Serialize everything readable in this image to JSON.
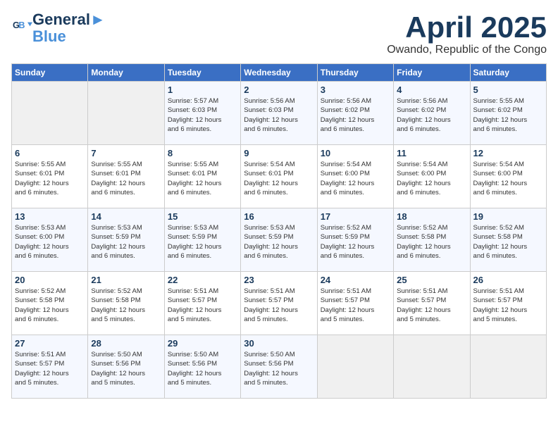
{
  "logo": {
    "line1": "General",
    "line2": "Blue"
  },
  "title": "April 2025",
  "subtitle": "Owando, Republic of the Congo",
  "days_of_week": [
    "Sunday",
    "Monday",
    "Tuesday",
    "Wednesday",
    "Thursday",
    "Friday",
    "Saturday"
  ],
  "weeks": [
    [
      {
        "num": "",
        "info": ""
      },
      {
        "num": "",
        "info": ""
      },
      {
        "num": "1",
        "info": "Sunrise: 5:57 AM\nSunset: 6:03 PM\nDaylight: 12 hours\nand 6 minutes."
      },
      {
        "num": "2",
        "info": "Sunrise: 5:56 AM\nSunset: 6:03 PM\nDaylight: 12 hours\nand 6 minutes."
      },
      {
        "num": "3",
        "info": "Sunrise: 5:56 AM\nSunset: 6:02 PM\nDaylight: 12 hours\nand 6 minutes."
      },
      {
        "num": "4",
        "info": "Sunrise: 5:56 AM\nSunset: 6:02 PM\nDaylight: 12 hours\nand 6 minutes."
      },
      {
        "num": "5",
        "info": "Sunrise: 5:55 AM\nSunset: 6:02 PM\nDaylight: 12 hours\nand 6 minutes."
      }
    ],
    [
      {
        "num": "6",
        "info": "Sunrise: 5:55 AM\nSunset: 6:01 PM\nDaylight: 12 hours\nand 6 minutes."
      },
      {
        "num": "7",
        "info": "Sunrise: 5:55 AM\nSunset: 6:01 PM\nDaylight: 12 hours\nand 6 minutes."
      },
      {
        "num": "8",
        "info": "Sunrise: 5:55 AM\nSunset: 6:01 PM\nDaylight: 12 hours\nand 6 minutes."
      },
      {
        "num": "9",
        "info": "Sunrise: 5:54 AM\nSunset: 6:01 PM\nDaylight: 12 hours\nand 6 minutes."
      },
      {
        "num": "10",
        "info": "Sunrise: 5:54 AM\nSunset: 6:00 PM\nDaylight: 12 hours\nand 6 minutes."
      },
      {
        "num": "11",
        "info": "Sunrise: 5:54 AM\nSunset: 6:00 PM\nDaylight: 12 hours\nand 6 minutes."
      },
      {
        "num": "12",
        "info": "Sunrise: 5:54 AM\nSunset: 6:00 PM\nDaylight: 12 hours\nand 6 minutes."
      }
    ],
    [
      {
        "num": "13",
        "info": "Sunrise: 5:53 AM\nSunset: 6:00 PM\nDaylight: 12 hours\nand 6 minutes."
      },
      {
        "num": "14",
        "info": "Sunrise: 5:53 AM\nSunset: 5:59 PM\nDaylight: 12 hours\nand 6 minutes."
      },
      {
        "num": "15",
        "info": "Sunrise: 5:53 AM\nSunset: 5:59 PM\nDaylight: 12 hours\nand 6 minutes."
      },
      {
        "num": "16",
        "info": "Sunrise: 5:53 AM\nSunset: 5:59 PM\nDaylight: 12 hours\nand 6 minutes."
      },
      {
        "num": "17",
        "info": "Sunrise: 5:52 AM\nSunset: 5:59 PM\nDaylight: 12 hours\nand 6 minutes."
      },
      {
        "num": "18",
        "info": "Sunrise: 5:52 AM\nSunset: 5:58 PM\nDaylight: 12 hours\nand 6 minutes."
      },
      {
        "num": "19",
        "info": "Sunrise: 5:52 AM\nSunset: 5:58 PM\nDaylight: 12 hours\nand 6 minutes."
      }
    ],
    [
      {
        "num": "20",
        "info": "Sunrise: 5:52 AM\nSunset: 5:58 PM\nDaylight: 12 hours\nand 6 minutes."
      },
      {
        "num": "21",
        "info": "Sunrise: 5:52 AM\nSunset: 5:58 PM\nDaylight: 12 hours\nand 5 minutes."
      },
      {
        "num": "22",
        "info": "Sunrise: 5:51 AM\nSunset: 5:57 PM\nDaylight: 12 hours\nand 5 minutes."
      },
      {
        "num": "23",
        "info": "Sunrise: 5:51 AM\nSunset: 5:57 PM\nDaylight: 12 hours\nand 5 minutes."
      },
      {
        "num": "24",
        "info": "Sunrise: 5:51 AM\nSunset: 5:57 PM\nDaylight: 12 hours\nand 5 minutes."
      },
      {
        "num": "25",
        "info": "Sunrise: 5:51 AM\nSunset: 5:57 PM\nDaylight: 12 hours\nand 5 minutes."
      },
      {
        "num": "26",
        "info": "Sunrise: 5:51 AM\nSunset: 5:57 PM\nDaylight: 12 hours\nand 5 minutes."
      }
    ],
    [
      {
        "num": "27",
        "info": "Sunrise: 5:51 AM\nSunset: 5:57 PM\nDaylight: 12 hours\nand 5 minutes."
      },
      {
        "num": "28",
        "info": "Sunrise: 5:50 AM\nSunset: 5:56 PM\nDaylight: 12 hours\nand 5 minutes."
      },
      {
        "num": "29",
        "info": "Sunrise: 5:50 AM\nSunset: 5:56 PM\nDaylight: 12 hours\nand 5 minutes."
      },
      {
        "num": "30",
        "info": "Sunrise: 5:50 AM\nSunset: 5:56 PM\nDaylight: 12 hours\nand 5 minutes."
      },
      {
        "num": "",
        "info": ""
      },
      {
        "num": "",
        "info": ""
      },
      {
        "num": "",
        "info": ""
      }
    ]
  ]
}
